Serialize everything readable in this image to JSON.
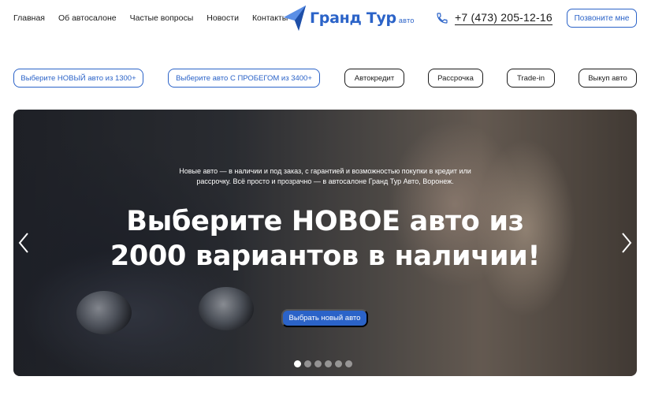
{
  "nav": {
    "items": [
      "Главная",
      "Об автосалоне",
      "Частые вопросы",
      "Новости",
      "Контакты"
    ]
  },
  "logo": {
    "name": "Гранд Тур",
    "suffix": "авто",
    "color": "#2b63c8"
  },
  "phone": {
    "number": "+7 (473) 205-12-16",
    "icon": "phone-icon"
  },
  "call_button": {
    "label": "Позвоните мне"
  },
  "categories": [
    "Выберите НОВЫЙ авто из 1300+",
    "Выберите авто С ПРОБЕГОМ из 3400+",
    "Автокредит",
    "Рассрочка",
    "Trade-in",
    "Выкуп авто"
  ],
  "hero": {
    "subtitle": "Новые авто — в наличии и под заказ, с гарантией и возможностью покупки в кредит или рассрочку. Всё просто и прозрачно — в автосалоне Гранд Тур Авто, Воронеж.",
    "title_line1": "Выберите НОВОЕ авто из",
    "title_line2": "2000 вариантов в наличии!",
    "button": "Выбрать новый авто",
    "slides_total": 6,
    "active_slide": 1
  },
  "colors": {
    "accent": "#2b63c8",
    "text": "#1a1a1a"
  }
}
